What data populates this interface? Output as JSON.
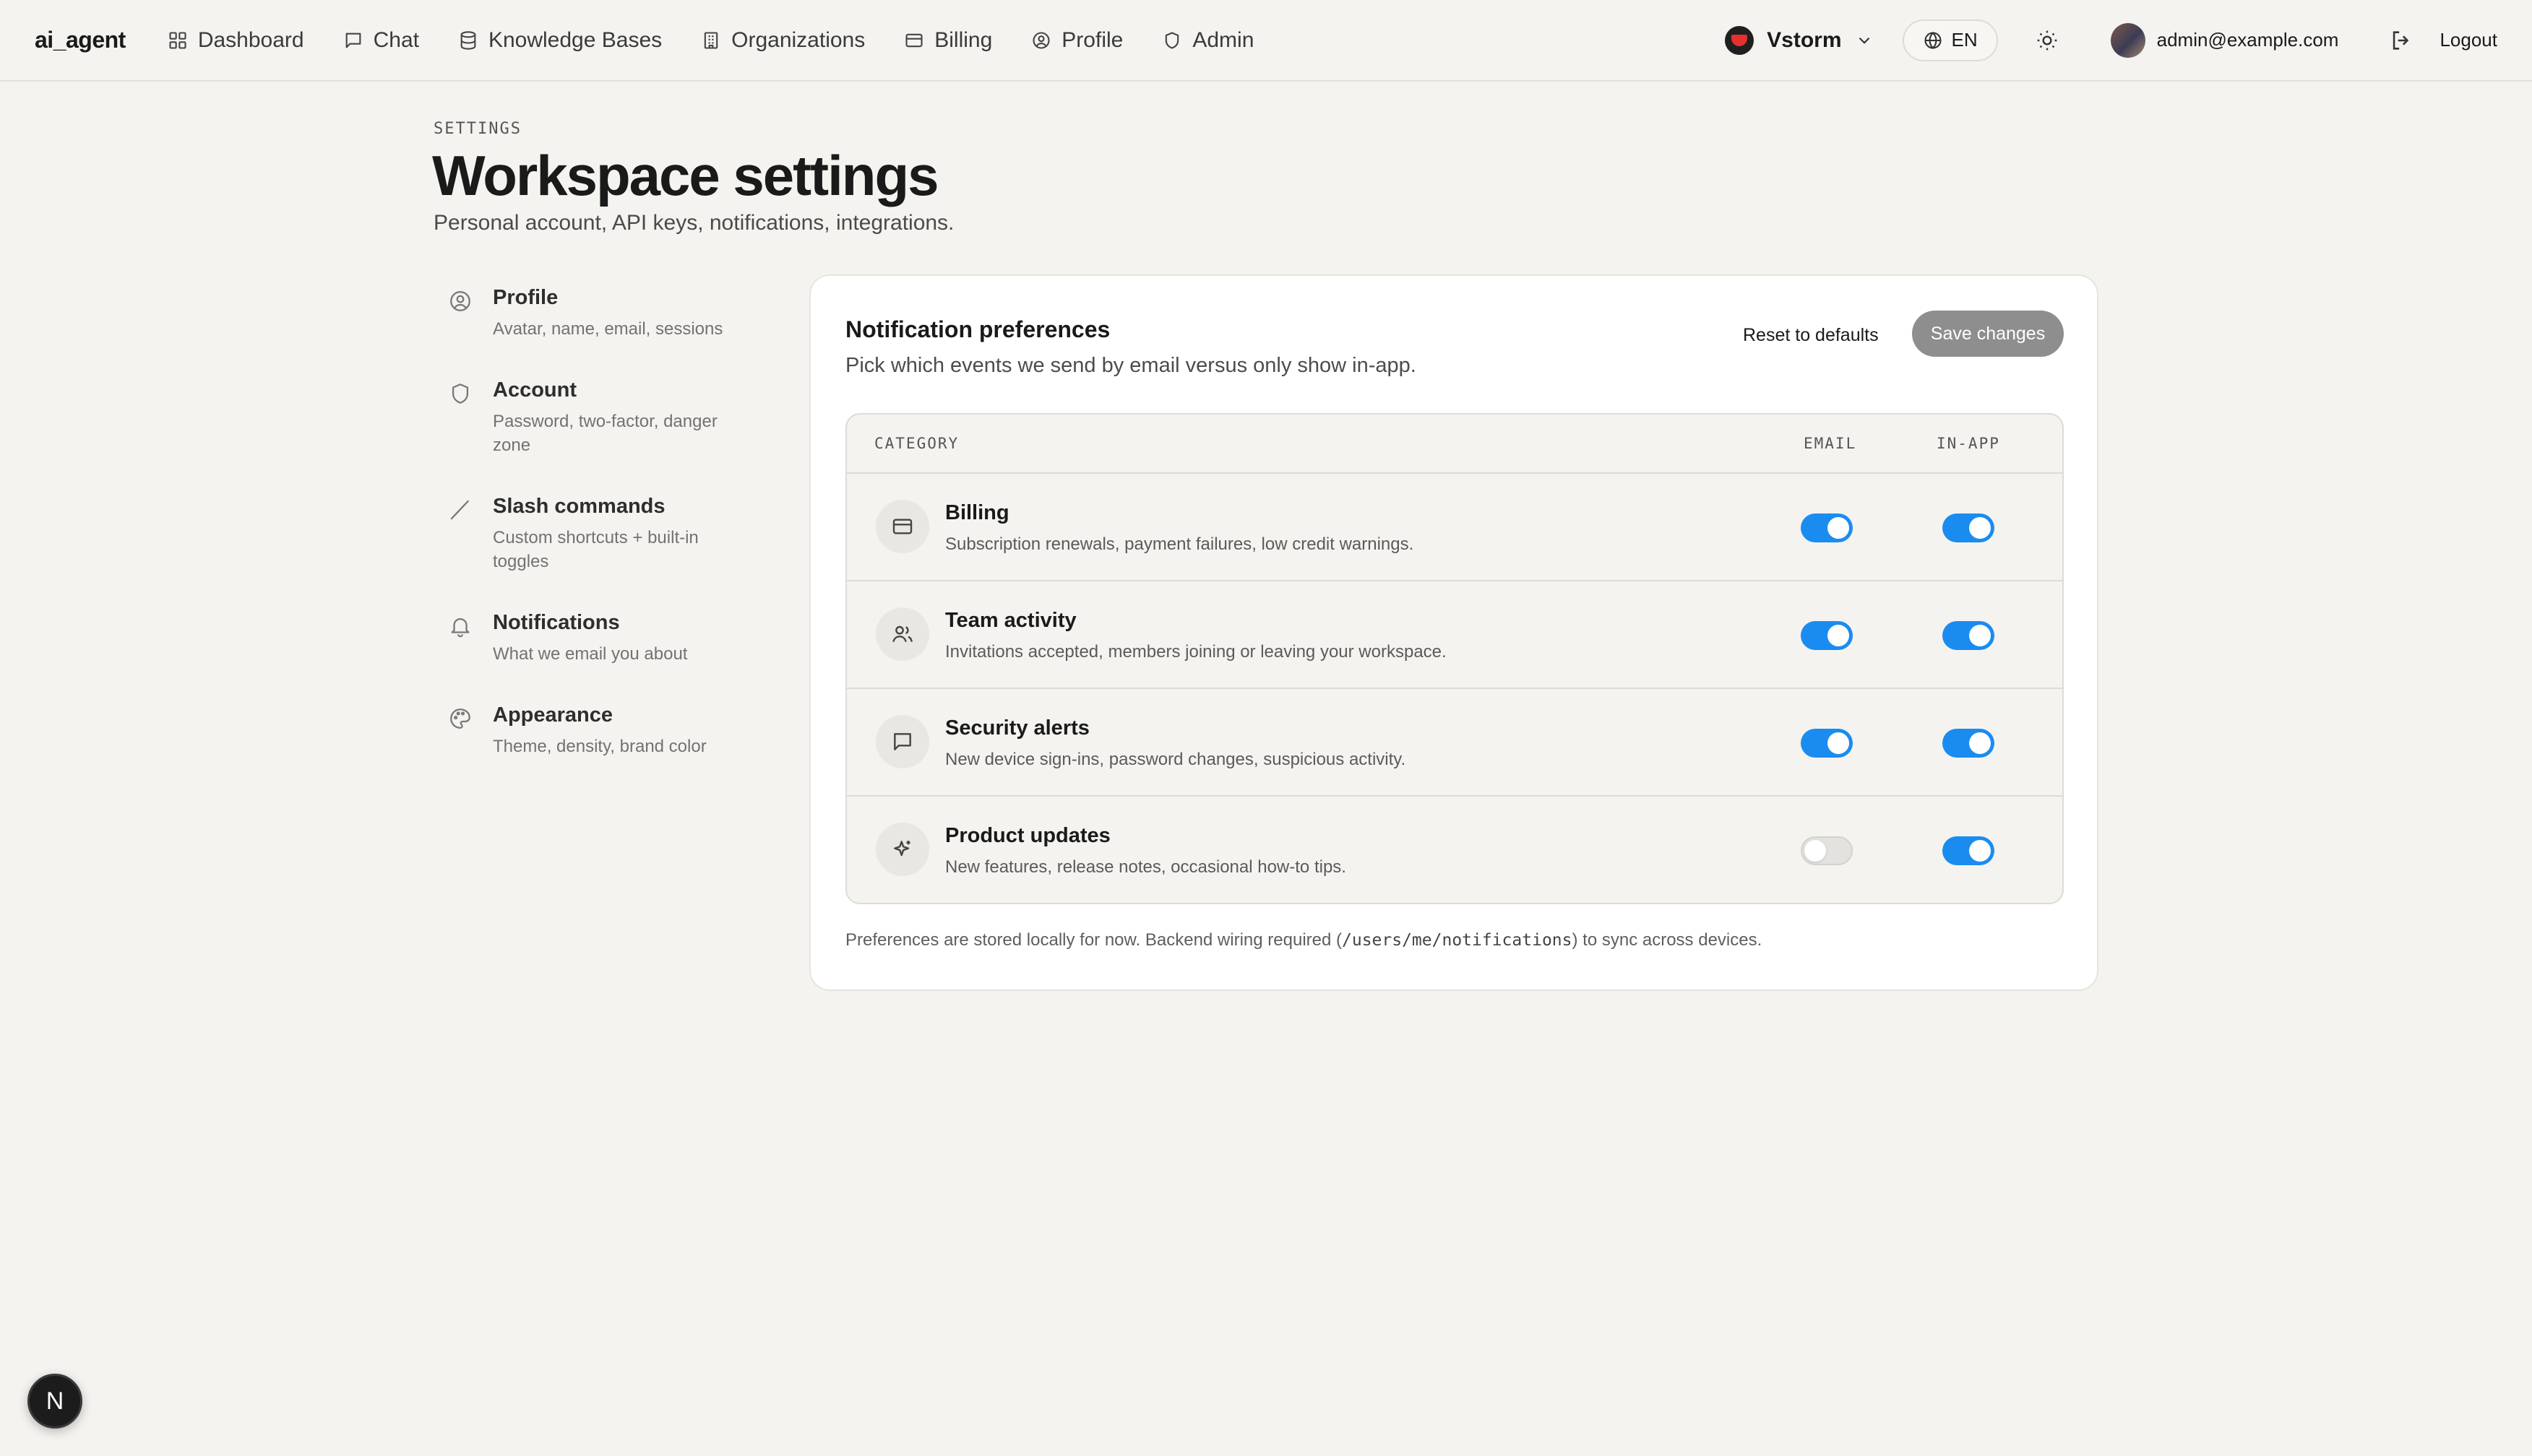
{
  "app": {
    "brand": "ai_agent"
  },
  "nav": {
    "items": [
      {
        "label": "Dashboard",
        "icon": "grid-icon"
      },
      {
        "label": "Chat",
        "icon": "chat-bubble-icon"
      },
      {
        "label": "Knowledge Bases",
        "icon": "database-icon"
      },
      {
        "label": "Organizations",
        "icon": "building-icon"
      },
      {
        "label": "Billing",
        "icon": "credit-card-icon"
      },
      {
        "label": "Profile",
        "icon": "user-circle-icon"
      },
      {
        "label": "Admin",
        "icon": "shield-icon"
      }
    ],
    "org_name": "Vstorm",
    "language": "EN",
    "user_email": "admin@example.com",
    "logout_label": "Logout"
  },
  "header": {
    "eyebrow": "SETTINGS",
    "title": "Workspace settings",
    "subtitle": "Personal account, API keys, notifications, integrations."
  },
  "side_menu": [
    {
      "title": "Profile",
      "desc": "Avatar, name, email, sessions",
      "icon": "user-circle-icon"
    },
    {
      "title": "Account",
      "desc": "Password, two-factor, danger zone",
      "icon": "shield-icon"
    },
    {
      "title": "Slash commands",
      "desc": "Custom shortcuts + built-in toggles",
      "icon": "slash-icon"
    },
    {
      "title": "Notifications",
      "desc": "What we email you about",
      "icon": "bell-icon"
    },
    {
      "title": "Appearance",
      "desc": "Theme, density, brand color",
      "icon": "palette-icon"
    }
  ],
  "card": {
    "title": "Notification preferences",
    "subtitle": "Pick which events we send by email versus only show in-app.",
    "reset_label": "Reset to defaults",
    "save_label": "Save changes",
    "columns": {
      "category": "CATEGORY",
      "email": "EMAIL",
      "in_app": "IN-APP"
    },
    "rows": [
      {
        "title": "Billing",
        "desc": "Subscription renewals, payment failures, low credit warnings.",
        "icon": "credit-card-icon",
        "email": true,
        "in_app": true
      },
      {
        "title": "Team activity",
        "desc": "Invitations accepted, members joining or leaving your workspace.",
        "icon": "users-icon",
        "email": true,
        "in_app": true
      },
      {
        "title": "Security alerts",
        "desc": "New device sign-ins, password changes, suspicious activity.",
        "icon": "message-square-icon",
        "email": true,
        "in_app": true
      },
      {
        "title": "Product updates",
        "desc": "New features, release notes, occasional how-to tips.",
        "icon": "sparkle-icon",
        "email": false,
        "in_app": true
      }
    ],
    "footnote_before": "Preferences are stored locally for now. Backend wiring required (",
    "footnote_code": "/users/me/notifications",
    "footnote_after": ") to sync across devices."
  },
  "corner_badge": "N",
  "colors": {
    "accent": "#1a8cf0",
    "background": "#f4f3ef",
    "save_button": "#8e8e8e",
    "org_logo_red": "#e63030"
  }
}
